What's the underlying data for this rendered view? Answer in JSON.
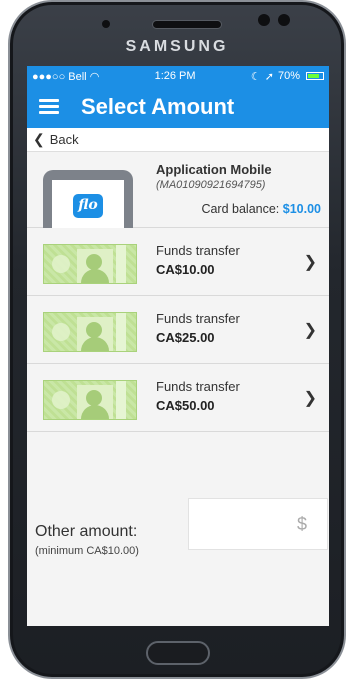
{
  "device": {
    "brand": "SAMSUNG"
  },
  "status_bar": {
    "carrier": "●●●○○ Bell",
    "time": "1:26 PM",
    "battery": "70%"
  },
  "header": {
    "title": "Select Amount"
  },
  "back": {
    "label": "Back"
  },
  "card": {
    "name": "Application Mobile",
    "number": "(MA01090921694795)",
    "logo_text": "flo",
    "balance_label": "Card balance:",
    "balance_value": "$10.00"
  },
  "options": [
    {
      "label": "Funds transfer",
      "amount": "CA$10.00"
    },
    {
      "label": "Funds transfer",
      "amount": "CA$25.00"
    },
    {
      "label": "Funds transfer",
      "amount": "CA$50.00"
    }
  ],
  "other_amount": {
    "label": "Other amount:",
    "minimum": "(minimum CA$10.00)",
    "currency_symbol": "$"
  },
  "colors": {
    "accent": "#1c8fe5",
    "background": "#f4f4f4"
  }
}
